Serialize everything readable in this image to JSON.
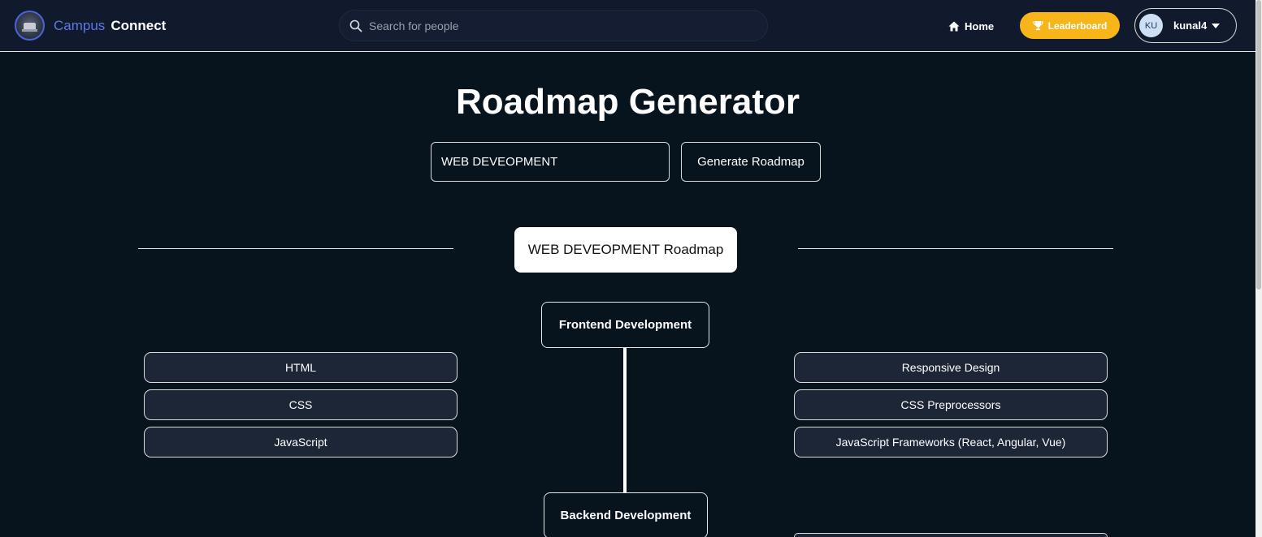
{
  "nav": {
    "brand_part1": "Campus",
    "brand_part2": "Connect",
    "search_placeholder": "Search for people",
    "home_label": "Home",
    "leaderboard_label": "Leaderboard",
    "user_initials": "KU",
    "username": "kunal4"
  },
  "page": {
    "title": "Roadmap Generator",
    "topic_value": "WEB DEVEOPMENT",
    "generate_label": "Generate Roadmap",
    "roadmap_title": "WEB DEVEOPMENT Roadmap"
  },
  "stages": [
    {
      "title": "Frontend Development",
      "left_items": [
        "HTML",
        "CSS",
        "JavaScript"
      ],
      "right_items": [
        "Responsive Design",
        "CSS Preprocessors",
        "JavaScript Frameworks (React, Angular, Vue)"
      ]
    },
    {
      "title": "Backend Development"
    }
  ],
  "colors": {
    "background": "#07131d",
    "navbar": "#111a2c",
    "brand_accent": "#5b78e6",
    "leaderboard": "#f8b519",
    "item_fill": "#1d2637"
  },
  "icons": {
    "search": "search-icon",
    "home": "home-icon",
    "leaderboard": "trophy-icon",
    "user_menu": "caret-down-icon"
  }
}
